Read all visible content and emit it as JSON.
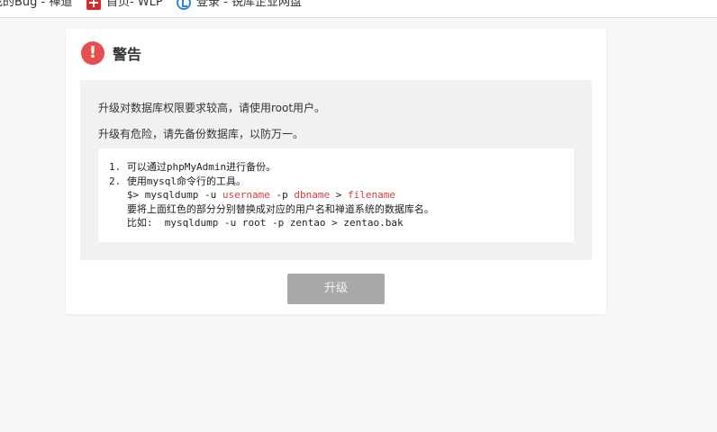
{
  "bookmarks": [
    {
      "label": "我的Bug - 禅道",
      "icon": "document-icon"
    },
    {
      "label": "首页- WLP",
      "icon": "red-plus-icon"
    },
    {
      "label": "登录 - 锐库企业网盘",
      "icon": "blue-circle-icon"
    }
  ],
  "dialog": {
    "title": "警告",
    "icon_symbol": "!",
    "line1": "升级对数据库权限要求较高，请使用root用户。",
    "line2": "升级有危险，请先备份数据库，以防万一。",
    "code": {
      "l1": "1. 可以通过phpMyAdmin进行备份。",
      "l2": "2. 使用mysql命令行的工具。",
      "l3_pre": "   $> mysqldump -u ",
      "l3_user": "username",
      "l3_mid1": " -p ",
      "l3_db": "dbname",
      "l3_mid2": " > ",
      "l3_file": "filename",
      "l4": "   要将上面红色的部分分别替换成对应的用户名和禅道系统的数据库名。",
      "l5": "   比如:  mysqldump -u root -p zentao > zentao.bak"
    },
    "button_label": "升级"
  },
  "colors": {
    "warning": "#e94e4e",
    "code_highlight": "#d23f3f",
    "button_disabled": "#a9a9a9",
    "panel_bg": "#f0f1f3",
    "page_bg": "#f6f7f9"
  }
}
